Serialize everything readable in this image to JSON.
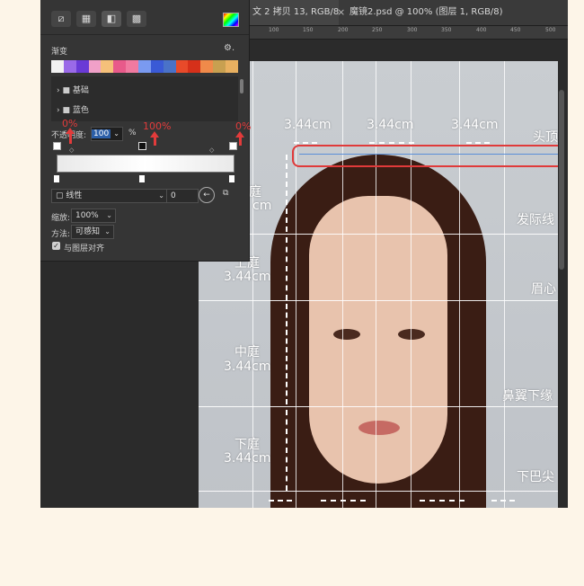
{
  "tabs": {
    "tab1": "文 2 拷贝 13, RGB/8)",
    "close": "×",
    "tab2": "魔镜2.psd @ 100% (图层 1, RGB/8)"
  },
  "ruler": [
    "100",
    "150",
    "200",
    "250",
    "300",
    "350",
    "400",
    "450",
    "500"
  ],
  "panel": {
    "title": "渐变",
    "gear": "⚙.",
    "folders": [
      "基础",
      "蓝色"
    ],
    "opacity_label": "不透明度:",
    "opacity_value": "100",
    "opacity_unit": "%",
    "style_value": "线性",
    "angle_value": "0",
    "scale_label": "缩放:",
    "scale_value": "100%",
    "method_label": "方法:",
    "method_value": "可感知",
    "align_label": "与图层对齐",
    "preset_colors": [
      "#f2f2f2",
      "#9a6ae8",
      "#6a3ad6",
      "#f0a0c8",
      "#f5c07a",
      "#e85a8a",
      "#f07aa0",
      "#7a9af0",
      "#3a5ad6",
      "#4a72c8",
      "#e84a2a",
      "#d6301a",
      "#f08a4a",
      "#c8a050",
      "#e8b060"
    ]
  },
  "annotations": {
    "pct_left": "0%",
    "pct_mid": "100%",
    "pct_right": "0%",
    "top_cm": [
      "3.44cm",
      "3.44cm",
      "3.44cm"
    ],
    "touding": "头顶",
    "fajixian": "发际线",
    "meixin": "眉心",
    "biyixia": "鼻翼下缘",
    "xiabajian": "下巴尖",
    "upper_ting": "上庭",
    "upper_cm": "3.44cm",
    "middle_ting": "中庭",
    "middle_cm": "3.44cm",
    "lower_ting": "下庭",
    "lower_cm": "3.44cm",
    "partial_ting": "庭",
    "partial_cm": "cm"
  }
}
